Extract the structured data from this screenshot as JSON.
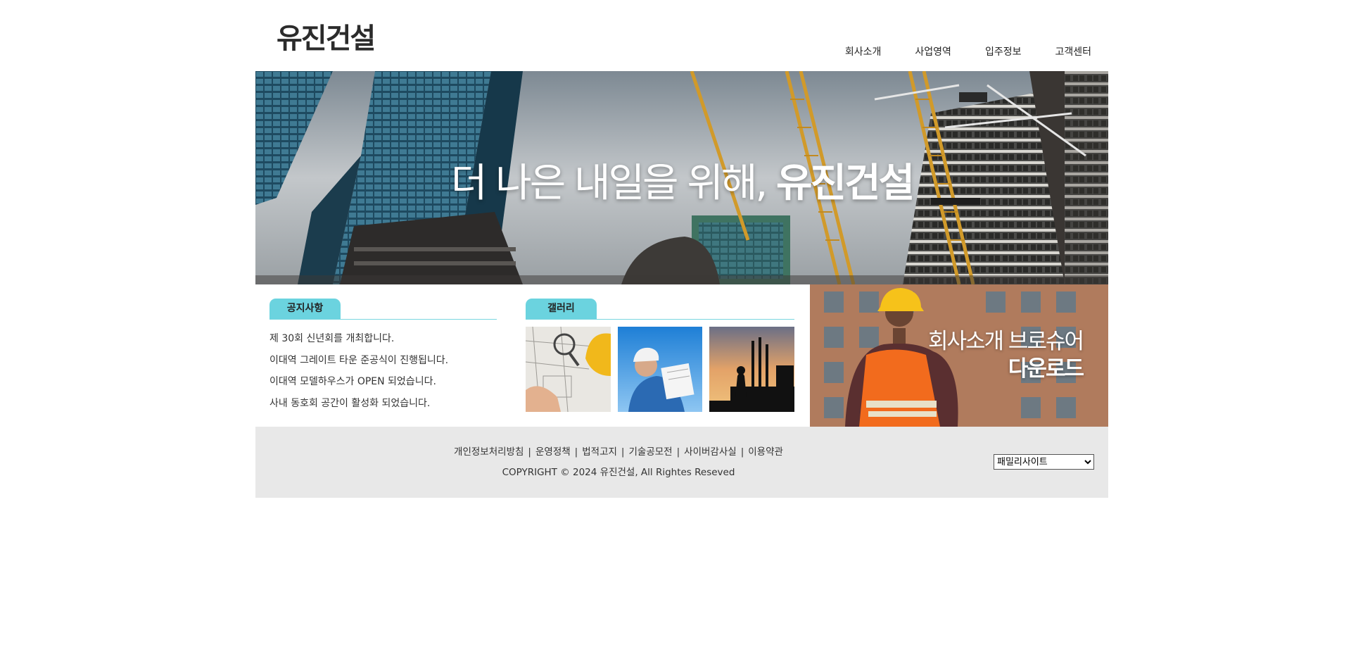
{
  "header": {
    "logo": "유진건설",
    "nav": [
      "회사소개",
      "사업영역",
      "입주정보",
      "고객센터"
    ]
  },
  "hero": {
    "title_regular": "더 나은 내일을 위해, ",
    "title_bold": "유진건설"
  },
  "notice": {
    "tab_label": "공지사항",
    "items": [
      "제 30회 신년회를 개최합니다.",
      "이대역 그레이트 타운 준공식이 진행됩니다.",
      "이대역 모델하우스가 OPEN 되었습니다.",
      "사내 동호회 공간이 활성화 되었습니다."
    ]
  },
  "gallery": {
    "tab_label": "갤러리"
  },
  "brochure": {
    "line1": "회사소개 브로슈어",
    "line2": "다운로드"
  },
  "footer": {
    "links": [
      "개인정보처리방침",
      "운영정책",
      "법적고지",
      "기술공모전",
      "사이버감사실",
      "이용약관"
    ],
    "copyright": "COPYRIGHT © 2024 유진건설, All Rightes Reseved",
    "family_site": "패밀리사이트"
  },
  "colors": {
    "tab_accent": "#6bd3df",
    "footer_bg": "#e8e8e8"
  }
}
